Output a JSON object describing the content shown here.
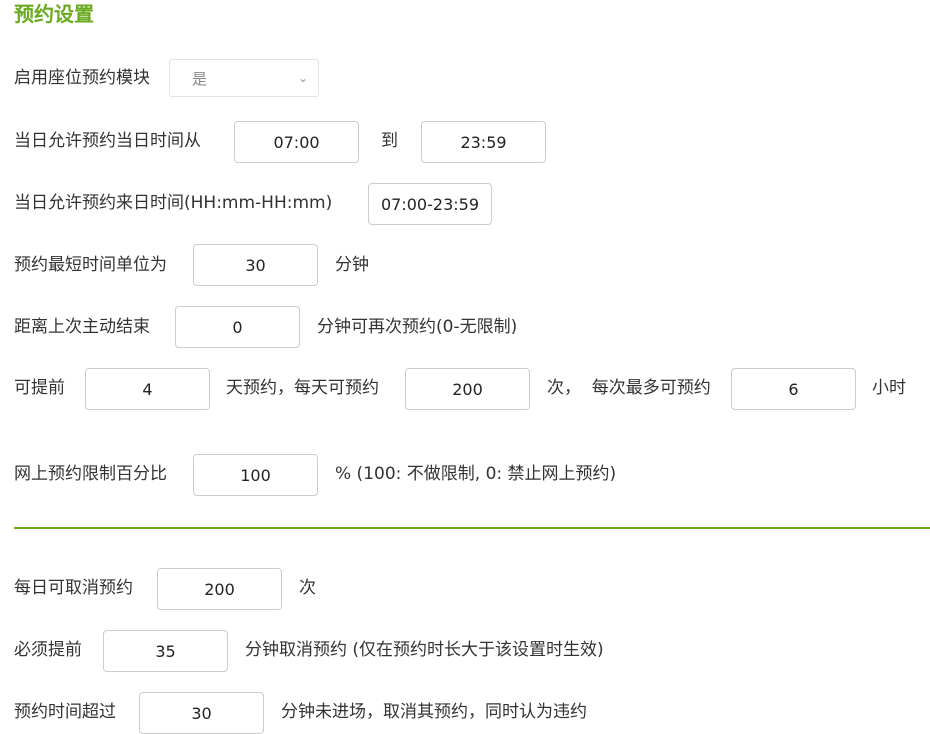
{
  "title": "预约设置",
  "module": {
    "label": "启用座位预约模块",
    "selected": "是"
  },
  "today": {
    "label": "当日允许预约当日时间从",
    "from": "07:00",
    "to_label": "到",
    "to": "23:59"
  },
  "next_day": {
    "label": "当日允许预约来日时间(HH:mm-HH:mm)",
    "value": "07:00-23:59"
  },
  "min_unit": {
    "label": "预约最短时间单位为",
    "value": "30",
    "unit": "分钟"
  },
  "interval": {
    "label": "距离上次主动结束",
    "value": "0",
    "suffix": "分钟可再次预约(0-无限制)"
  },
  "advance": {
    "label": "可提前",
    "days": "4",
    "days_suffix": "天预约，每天可预约",
    "times": "200",
    "times_suffix": "次，  每次最多可预约",
    "hours": "6",
    "hours_suffix": "小时"
  },
  "online": {
    "label": "网上预约限制百分比",
    "value": "100",
    "suffix": "% (100: 不做限制, 0: 禁止网上预约)"
  },
  "cancel": {
    "label": "每日可取消预约",
    "value": "200",
    "suffix": "次"
  },
  "cancel_advance": {
    "label": "必须提前",
    "value": "35",
    "suffix": "分钟取消预约 (仅在预约时长大于该设置时生效)"
  },
  "timeout": {
    "label": "预约时间超过",
    "value": "30",
    "suffix": "分钟未进场，取消其预约，同时认为违约"
  },
  "colors": {
    "accent": "#6aaa1e",
    "border": "#cccccc"
  }
}
